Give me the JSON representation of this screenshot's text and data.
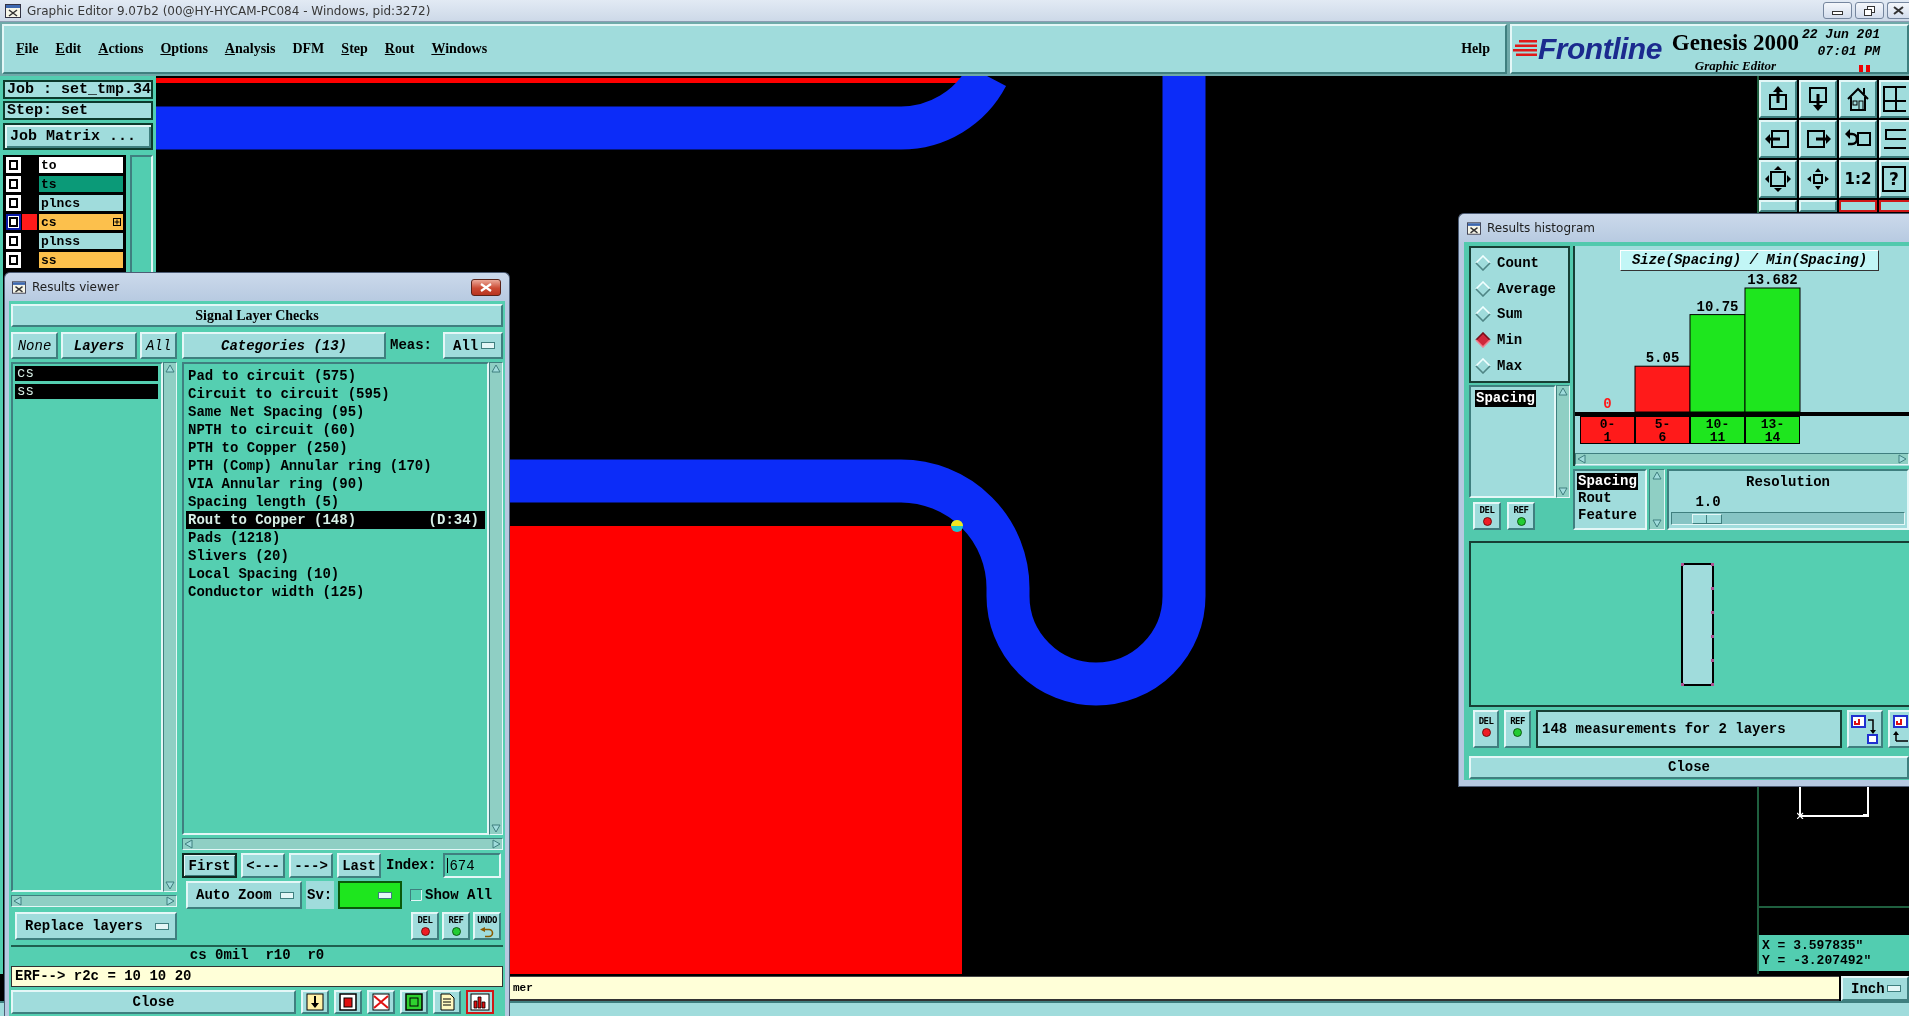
{
  "window": {
    "title": "Graphic Editor 9.07b2 (00@HY-HYCAM-PC084 - Windows, pid:3272)"
  },
  "menu": [
    {
      "label": "File",
      "mnemonic": true
    },
    {
      "label": "Edit",
      "mnemonic": true
    },
    {
      "label": "Actions",
      "mnemonic": true
    },
    {
      "label": "Options",
      "mnemonic": true
    },
    {
      "label": "Analysis",
      "mnemonic": true
    },
    {
      "label": "DFM",
      "mnemonic": false
    },
    {
      "label": "Step",
      "mnemonic": true
    },
    {
      "label": "Rout",
      "mnemonic": true
    },
    {
      "label": "Windows",
      "mnemonic": true
    }
  ],
  "help": {
    "label": "Help"
  },
  "brand": {
    "logo": "Frontline",
    "product": "Genesis 2000",
    "subtitle": "Graphic Editor",
    "date": "22 Jun 201",
    "time": "07:01 PM"
  },
  "job": {
    "job": "Job : set_tmp.34",
    "step": "Step: set",
    "matrix_button": "Job Matrix ..."
  },
  "layers": [
    {
      "name": "to",
      "color": "#ffffff",
      "checked": false,
      "active": false
    },
    {
      "name": "ts",
      "color": "#0b9a78",
      "checked": false,
      "active": false
    },
    {
      "name": "plncs",
      "color": "#a0dcdc",
      "checked": false,
      "active": false
    },
    {
      "name": "cs",
      "color": "#fcc04c",
      "checked": false,
      "active": true,
      "swatch": {
        "color": "#ff1a1a"
      }
    },
    {
      "name": "plnss",
      "color": "#a0dcdc",
      "checked": false,
      "active": false
    },
    {
      "name": "ss",
      "color": "#fcc04c",
      "checked": false,
      "active": false
    }
  ],
  "toolbar": {
    "zoom_ratio": "1:2",
    "help": "?"
  },
  "readout": {
    "x": "X = 3.597835\"",
    "y": "Y = -3.207492\""
  },
  "status_bar": {
    "message": "mer",
    "units": "Inch"
  },
  "results_viewer": {
    "title": "Results viewer",
    "header": "Signal Layer Checks",
    "layer_buttons": {
      "none": "None",
      "layers": "Layers",
      "all": "All"
    },
    "layers": [
      {
        "label": "cs",
        "selected": true
      },
      {
        "label": "ss",
        "selected": true
      }
    ],
    "categories_button": "Categories (13)",
    "meas_label": "Meas:",
    "meas_value": "All",
    "categories": [
      {
        "label": "Pad to circuit (575)",
        "selected": false
      },
      {
        "label": "Circuit to circuit (595)",
        "selected": false
      },
      {
        "label": "Same Net Spacing (95)",
        "selected": false
      },
      {
        "label": "NPTH to circuit (60)",
        "selected": false
      },
      {
        "label": "PTH to Copper (250)",
        "selected": false
      },
      {
        "label": "PTH (Comp) Annular ring (170)",
        "selected": false
      },
      {
        "label": "VIA Annular ring (90)",
        "selected": false
      },
      {
        "label": "Spacing length (5)",
        "selected": false
      },
      {
        "label": "Rout to Copper (148)",
        "detail": "(D:34)",
        "selected": true
      },
      {
        "label": "Pads (1218)",
        "selected": false
      },
      {
        "label": "Slivers (20)",
        "selected": false
      },
      {
        "label": "Local Spacing (10)",
        "selected": false
      },
      {
        "label": "Conductor width (125)",
        "selected": false
      }
    ],
    "nav": {
      "first": "First",
      "prev": "<---",
      "next": "--->",
      "last": "Last"
    },
    "index": {
      "label": "Index:",
      "value": "674"
    },
    "zoom_mode": "Auto Zoom",
    "severity": {
      "label": "Sv:",
      "color": "#1ee61e"
    },
    "show_all": {
      "label": "Show All",
      "checked": false
    },
    "replace_mode": "Replace layers",
    "tools": [
      {
        "label": "DEL",
        "kind": "delete"
      },
      {
        "label": "REF",
        "kind": "reference"
      },
      {
        "label": "UNDO",
        "kind": "undo"
      }
    ],
    "status": "cs 0mil  r10  r0",
    "command": "ERF--> r2c = 10 10 20",
    "close": "Close"
  },
  "results_histogram": {
    "title": "Results histogram",
    "statistics": [
      {
        "label": "Count",
        "selected": false
      },
      {
        "label": "Average",
        "selected": false
      },
      {
        "label": "Sum",
        "selected": false
      },
      {
        "label": "Min",
        "selected": true
      },
      {
        "label": "Max",
        "selected": false
      }
    ],
    "attributes": [
      {
        "label": "Spacing",
        "selected": true
      }
    ],
    "attribute_tools": [
      {
        "label": "DEL",
        "kind": "delete"
      },
      {
        "label": "REF",
        "kind": "reference"
      }
    ],
    "chart_data": {
      "type": "bar",
      "title": "Size(Spacing) / Min(Spacing)",
      "categories": [
        "0-1",
        "5-6",
        "10-11",
        "13-14"
      ],
      "values": [
        0,
        5.05,
        10.75,
        13.682
      ],
      "value_labels": [
        "0",
        "5.05",
        "10.75",
        "13.682"
      ],
      "colors": [
        "#ff1a1a",
        "#ff1a1a",
        "#1ee61e",
        "#1ee61e"
      ]
    },
    "fields": [
      {
        "label": "Spacing",
        "selected": true
      },
      {
        "label": "Rout",
        "selected": false
      },
      {
        "label": "Feature",
        "selected": false
      }
    ],
    "resolution": {
      "label": "Resolution",
      "value": "1.0",
      "level": 0.1
    },
    "tools": [
      {
        "label": "DEL",
        "kind": "delete"
      },
      {
        "label": "REF",
        "kind": "reference"
      }
    ],
    "summary": "148 measurements for 2 layers",
    "close": "Close"
  }
}
